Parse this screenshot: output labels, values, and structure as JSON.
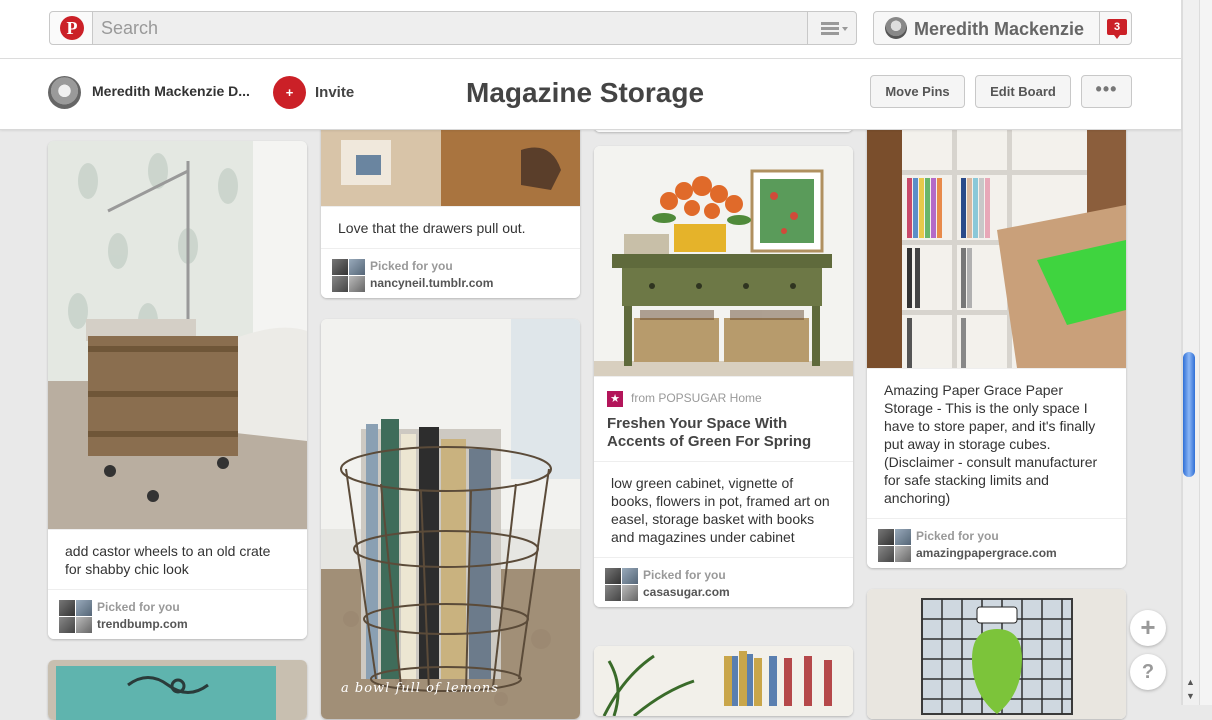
{
  "topbar": {
    "logo_letter": "P",
    "search_placeholder": "Search",
    "user_name": "Meredith Mackenzie",
    "notification_count": "3"
  },
  "board": {
    "owner_name": "Meredith Mackenzie D...",
    "invite_icon": "+",
    "invite_label": "Invite",
    "title": "Magazine Storage",
    "move_pins_label": "Move Pins",
    "edit_board_label": "Edit Board",
    "more_label": "•••"
  },
  "pins": [
    {
      "description": "add castor wheels to an old crate for shabby chic look",
      "picked_label": "Picked for you",
      "domain": "trendbump.com"
    },
    {
      "description": "Love that the drawers pull out.",
      "picked_label": "Picked for you",
      "domain": "nancyneil.tumblr.com"
    },
    {
      "image_caption": "a bowl full of lemons"
    },
    {
      "attribution": "from POPSUGAR Home",
      "rich_title": "Freshen Your Space With Accents of Green For Spring",
      "description": "low green cabinet, vignette of books, flowers in pot, framed art on easel, storage basket with books and magazines under cabinet",
      "picked_label": "Picked for you",
      "domain": "casasugar.com"
    },
    {
      "description": "Amazing Paper Grace Paper Storage - This is the only space I have to store paper, and it's finally put away in storage cubes. (Disclaimer - consult manufacturer for safe stacking limits and anchoring)",
      "picked_label": "Picked for you",
      "domain": "amazingpapergrace.com"
    }
  ],
  "floating": {
    "add_label": "+",
    "help_label": "?"
  },
  "colors": {
    "brand_red": "#cb2027",
    "popsugar_pink": "#b3155a",
    "scroll_thumb_blue": "#2f6fd6"
  }
}
